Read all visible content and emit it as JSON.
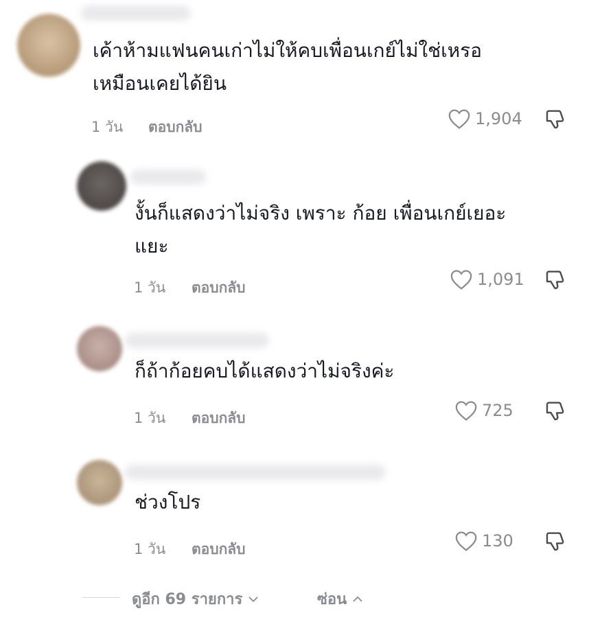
{
  "comments": [
    {
      "text_lines": [
        "เค้าห้ามแฟนคนเก่าไม่ให้คบเพื่อนเกย์ไม่ใช่เหรอ",
        "เหมือนเคยได้ยิน"
      ],
      "time": "1 วัน",
      "reply_label": "ตอบกลับ",
      "likes": "1,904"
    },
    {
      "text_lines": [
        "งั้นก็แสดงว่าไม่จริง เพราะ ก้อย เพื่อนเกย์เยอะ",
        "แยะ"
      ],
      "time": "1 วัน",
      "reply_label": "ตอบกลับ",
      "likes": "1,091"
    },
    {
      "text_lines": [
        "ก็ถ้าก้อยคบได้แสดงว่าไม่จริงค่ะ"
      ],
      "time": "1 วัน",
      "reply_label": "ตอบกลับ",
      "likes": "725"
    },
    {
      "text_lines": [
        "ช่วงโปร"
      ],
      "time": "1 วัน",
      "reply_label": "ตอบกลับ",
      "likes": "130"
    }
  ],
  "footer": {
    "view_more": "ดูอีก 69 รายการ",
    "hide": "ซ่อน"
  },
  "icons": {
    "like": "heart-outline-icon",
    "dislike": "thumbs-down-icon",
    "expand": "chevron-down-icon",
    "collapse": "chevron-up-icon"
  },
  "colors": {
    "text": "#161823",
    "muted": "#8a8b91"
  }
}
